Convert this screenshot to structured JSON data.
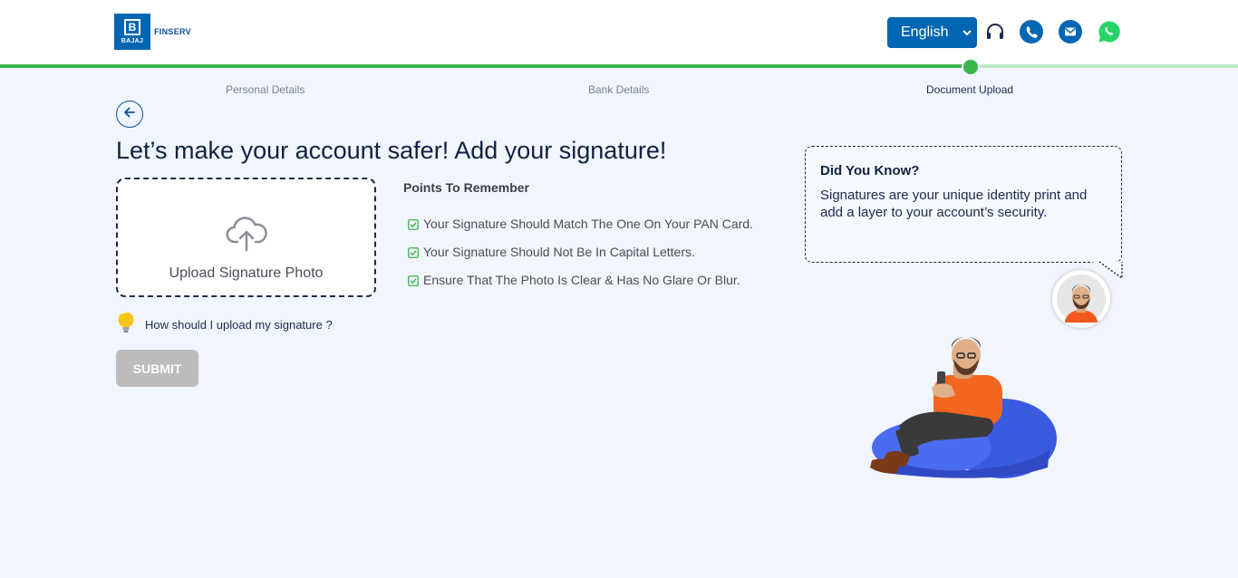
{
  "brand": {
    "logo_mark": "B",
    "logo_word": "BAJAJ",
    "logo_text": "FINSERV"
  },
  "header": {
    "language": "English",
    "icons": [
      "headset-icon",
      "phone-icon",
      "mail-icon",
      "whatsapp-icon"
    ]
  },
  "progress": {
    "steps": [
      "Personal Details",
      "Bank Details",
      "Document Upload"
    ],
    "current_step": 3
  },
  "main": {
    "title": "Let’s make your account safer! Add your signature!",
    "upload_label": "Upload Signature Photo",
    "hint": "How should I upload my signature ?",
    "submit_label": "SUBMIT"
  },
  "points": {
    "title": "Points To Remember",
    "items": [
      "Your Signature Should Match The One On Your PAN Card.",
      "Your Signature Should Not Be In Capital Letters.",
      "Ensure That The Photo Is Clear & Has No Glare Or Blur."
    ]
  },
  "did_you_know": {
    "title": "Did You Know?",
    "text": "Signatures are your unique identity print and add a layer to your account’s security."
  },
  "colors": {
    "brand_blue": "#0066b3",
    "progress_green": "#3ab54a",
    "whatsapp_green": "#25d366",
    "background": "#f1f5fd"
  }
}
